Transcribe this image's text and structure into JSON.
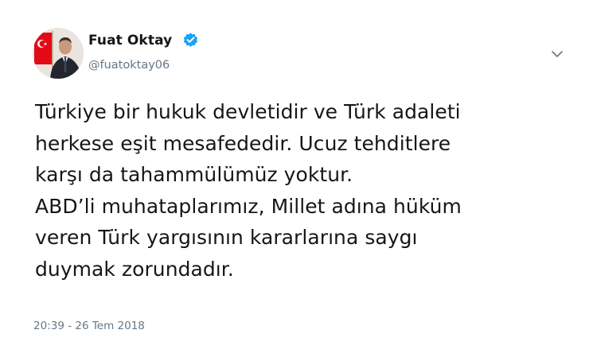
{
  "author": {
    "name": "Fuat Oktay",
    "handle": "@fuatoktay06",
    "verified_icon": "verified-badge-icon",
    "avatar_icon": "profile-photo-with-flag"
  },
  "tweet": {
    "lines": [
      "Türkiye bir hukuk devletidir ve Türk adaleti",
      "herkese eşit mesafededir. Ucuz tehditlere",
      "karşı da tahammülümüz yoktur.",
      "ABD’li muhataplarımız, Millet adına hüküm",
      "veren Türk yargısının kararlarına saygı",
      "duymak zorundadır."
    ],
    "timestamp": "20:39 - 26 Tem 2018"
  },
  "menu": {
    "icon": "chevron-down-icon"
  },
  "colors": {
    "text": "#14171a",
    "secondary": "#657786",
    "verified": "#1da1f2",
    "flag_red": "#e30a17"
  }
}
